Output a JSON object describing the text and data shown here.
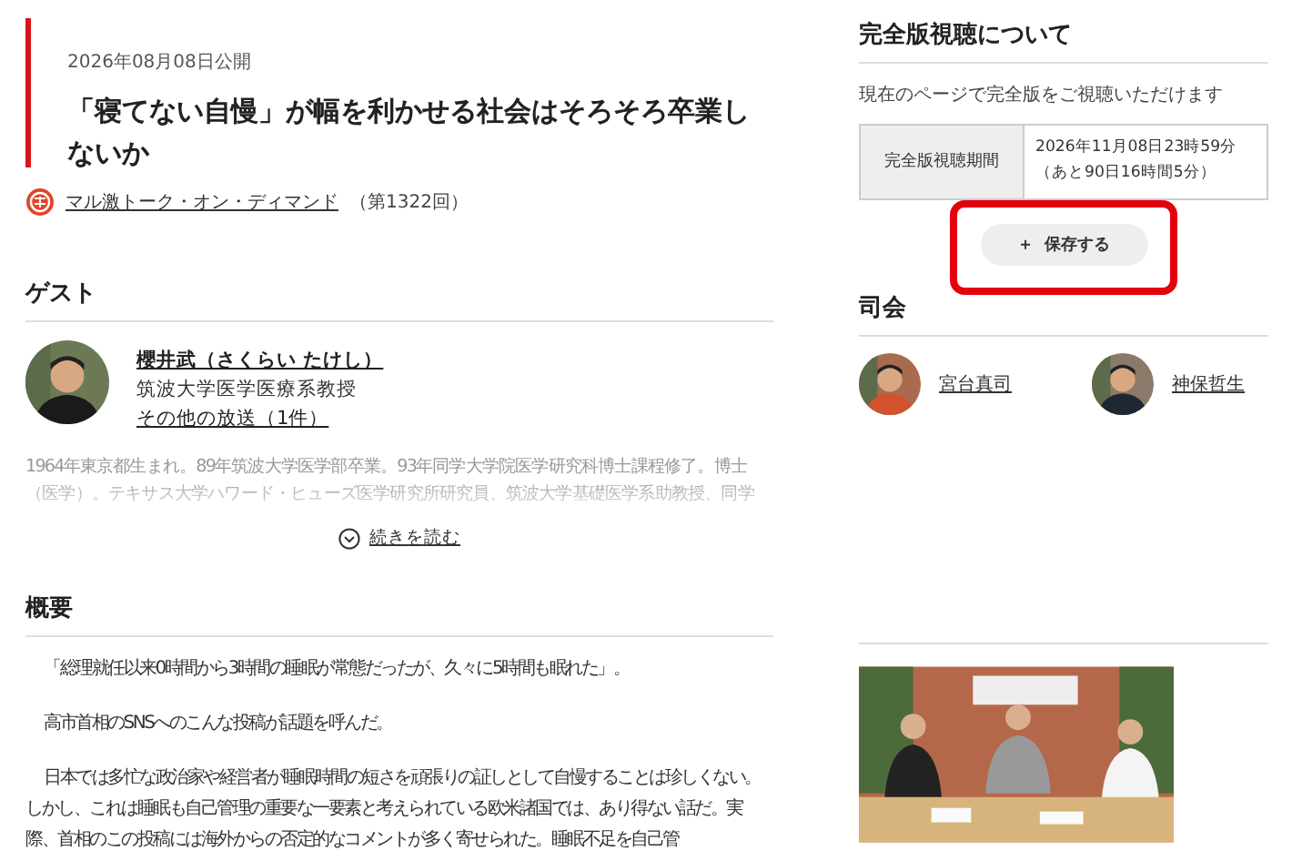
{
  "article": {
    "published": "2026年08月08日公開",
    "title": "「寝てない自慢」が幅を利かせる社会はそろそろ卒業しないか",
    "program": {
      "name": "マル激トーク・オン・ディマンド",
      "episode": "（第1322回）"
    }
  },
  "guest": {
    "heading": "ゲスト",
    "name": "櫻井武（さくらい たけし）",
    "affiliation": "筑波大学医学医療系教授",
    "other_link": "その他の放送（1件）",
    "bio": "1964年東京都生まれ。89年筑波大学医学部卒業。93年同学大学院医学研究科博士課程修了。博士（医学）。テキサス大学ハワード・ヒューズ医学研究所研究員、筑波大学基礎医学系助教授、同学",
    "more": "続きを読む"
  },
  "summary": {
    "heading": "概要",
    "paragraphs": [
      "「総理就任以来0時間から3時間の睡眠が常態だったが、久々に5時間も眠れた」。",
      "高市首相のSNSへのこんな投稿が話題を呼んだ。",
      "日本では多忙な政治家や経営者が睡眠時間の短さを頑張りの証しとして自慢することは珍しくない。しかし、これは睡眠も自己管理の重要な一要素と考えられている欧米諸国では、あり得ない話だ。実際、首相のこの投稿には海外からの否定的なコメントが多く寄せられた。睡眠不足を自己管"
    ]
  },
  "viewing": {
    "heading": "完全版視聴について",
    "note": "現在のページで完全版をご視聴いただけます",
    "period_label": "完全版視聴期間",
    "period_value": [
      "2026年11月08日23時59分",
      "（あと90日16時間5分）"
    ],
    "save_button": {
      "icon": "＋",
      "label": "保存する",
      "highlighted": true
    }
  },
  "hosts": {
    "heading": "司会",
    "items": [
      {
        "name": "宮台真司"
      },
      {
        "name": "神保哲生"
      }
    ]
  }
}
